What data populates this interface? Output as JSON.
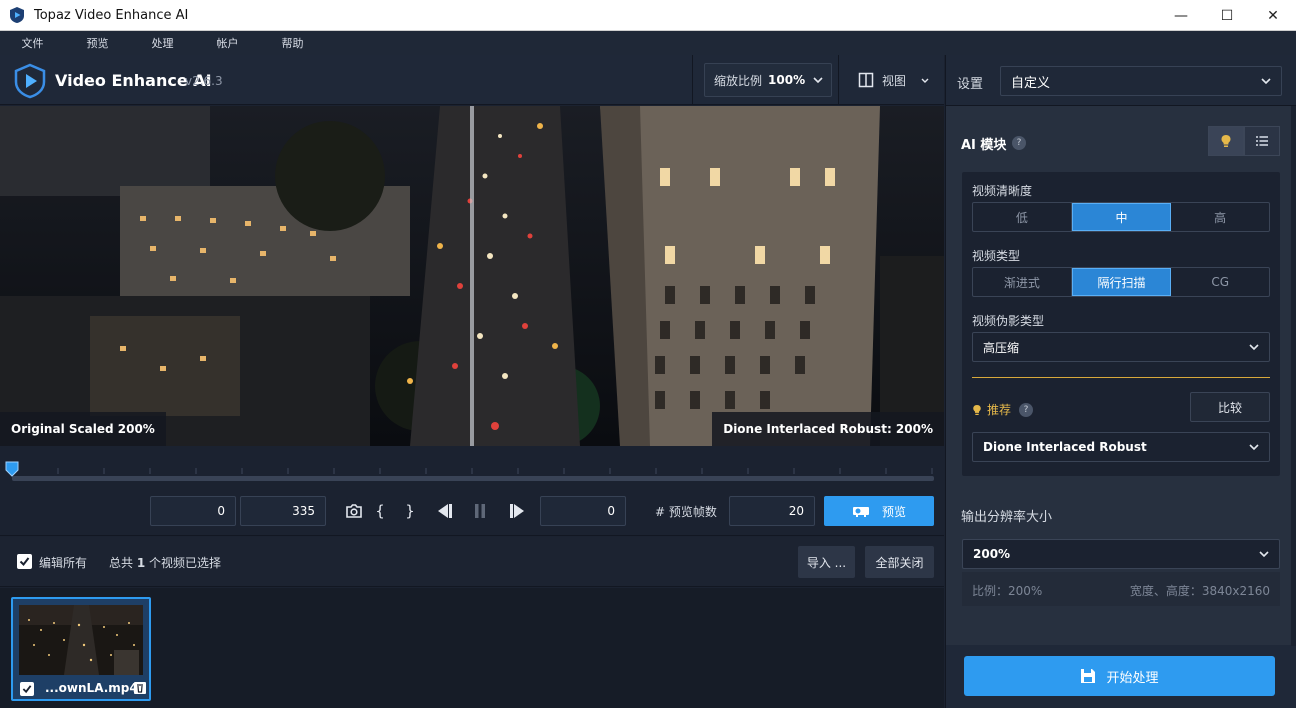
{
  "window": {
    "title": "Topaz Video Enhance AI",
    "minimize": "—",
    "maximize": "☐",
    "close": "✕"
  },
  "menu": [
    "文件",
    "预览",
    "处理",
    "帐户",
    "帮助"
  ],
  "header": {
    "brand": "Video Enhance AI",
    "version": "v2.6.3",
    "zoom_label": "缩放比例",
    "zoom_value": "100%",
    "view_label": "视图"
  },
  "preview": {
    "left_caption": "Original Scaled 200%",
    "right_caption": "Dione Interlaced Robust: 200%"
  },
  "timeline": {
    "position": 0.0
  },
  "controls": {
    "start_frame": "0",
    "end_frame": "335",
    "current_frame": "0",
    "frames_label": "# 预览帧数",
    "frames_value": "20",
    "preview_button": "预览",
    "bracket_open": "{",
    "bracket_close": "}"
  },
  "editbar": {
    "edit_all_label": "编辑所有",
    "selected_prefix": "总共 ",
    "selected_count": "1",
    "selected_suffix": " 个视频已选择",
    "import_button": "导入 ...",
    "close_all_button": "全部关闭"
  },
  "files": [
    {
      "name": "...ownLA.mp4",
      "checked": true
    }
  ],
  "settings": {
    "label": "设置",
    "preset": "自定义",
    "ai_model_label": "AI 模块",
    "help": "?",
    "clarity_label": "视频清晰度",
    "clarity_options": [
      "低",
      "中",
      "高"
    ],
    "clarity_selected": 1,
    "type_label": "视频类型",
    "type_options": [
      "渐进式",
      "隔行扫描",
      "CG"
    ],
    "type_selected": 1,
    "artifact_label": "视频伪影类型",
    "artifact_value": "高压缩",
    "recommend_label": "推荐",
    "compare_button": "比较",
    "model_value": "Dione Interlaced Robust",
    "output_label": "输出分辨率大小",
    "output_value": "200%",
    "ratio_text": "比例：200%",
    "size_text": "宽度、高度：3840x2160",
    "start_button": "开始处理"
  },
  "colors": {
    "accent": "#2e9bf0",
    "recommend": "#e5b84a"
  }
}
